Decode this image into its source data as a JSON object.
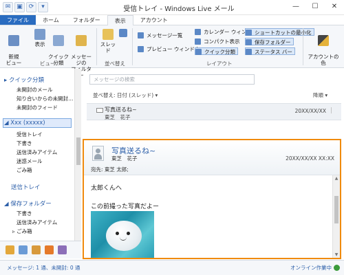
{
  "window": {
    "title": "受信トレイ - Windows Live メール",
    "minimize": "—",
    "maximize": "☐",
    "close": "✕"
  },
  "tabs": [
    "ファイル",
    "ホーム",
    "フォルダー",
    "表示",
    "アカウント"
  ],
  "ribbon": {
    "new_view": "新規\nビュー",
    "show": "表示",
    "quick_views": "クイック\n分類",
    "message_filter": "メッセージの\nフィルター",
    "thread": "スレッド",
    "view_group": "ビュー",
    "sort_group": "並べ替え",
    "message_list": "メッセージ一覧",
    "preview_window": "プレビュー ウィンドウ",
    "calendar_window": "カレンダー ウィンドウ",
    "compact_view": "コンパクト表示",
    "quick_views_toggle": "クイック分類",
    "shortcut_min": "ショートカットの最小化",
    "storage_folder": "保存フォルダー",
    "status_bar": "ステータス バー",
    "layout_group": "レイアウト",
    "account_color": "アカウントの\n色"
  },
  "nav": {
    "quick_views_header": "クイック分類",
    "quick_items": [
      "未開封のメール",
      "知り合いからの未開封…",
      "未開封のフィード"
    ],
    "account_header": "Xxx (xxxxx)",
    "account_items": [
      "受信トレイ",
      "下書き",
      "送信済みアイテム",
      "迷惑メール",
      "ごみ箱"
    ],
    "outbox": "送信トレイ",
    "storage_header": "保存フォルダー",
    "storage_items": [
      "下書き",
      "送信済みアイテム",
      "ごみ箱"
    ]
  },
  "list": {
    "search_placeholder": "メッセージの検索",
    "sort_label": "並べ替え: 日付 (スレッド)",
    "sort_dir": "降順",
    "messages": [
      {
        "subject": "写真送るね~",
        "from": "東芝　花子",
        "date": "20XX/XX/XX"
      }
    ]
  },
  "reading": {
    "subject": "写真送るね~",
    "from": "東芝　花子",
    "date": "20XX/XX/XX XX:XX",
    "to": "宛先: 東芝 太郎;",
    "line1": "太郎くんへ",
    "line2": "この前撮った写真だよー"
  },
  "status": {
    "left": "メッセージ: 1 通、未開封: 0 通",
    "right": "オンライン作業中"
  },
  "colors": {
    "accent": "#2a6cc0",
    "highlight_border": "#f08a0c"
  }
}
